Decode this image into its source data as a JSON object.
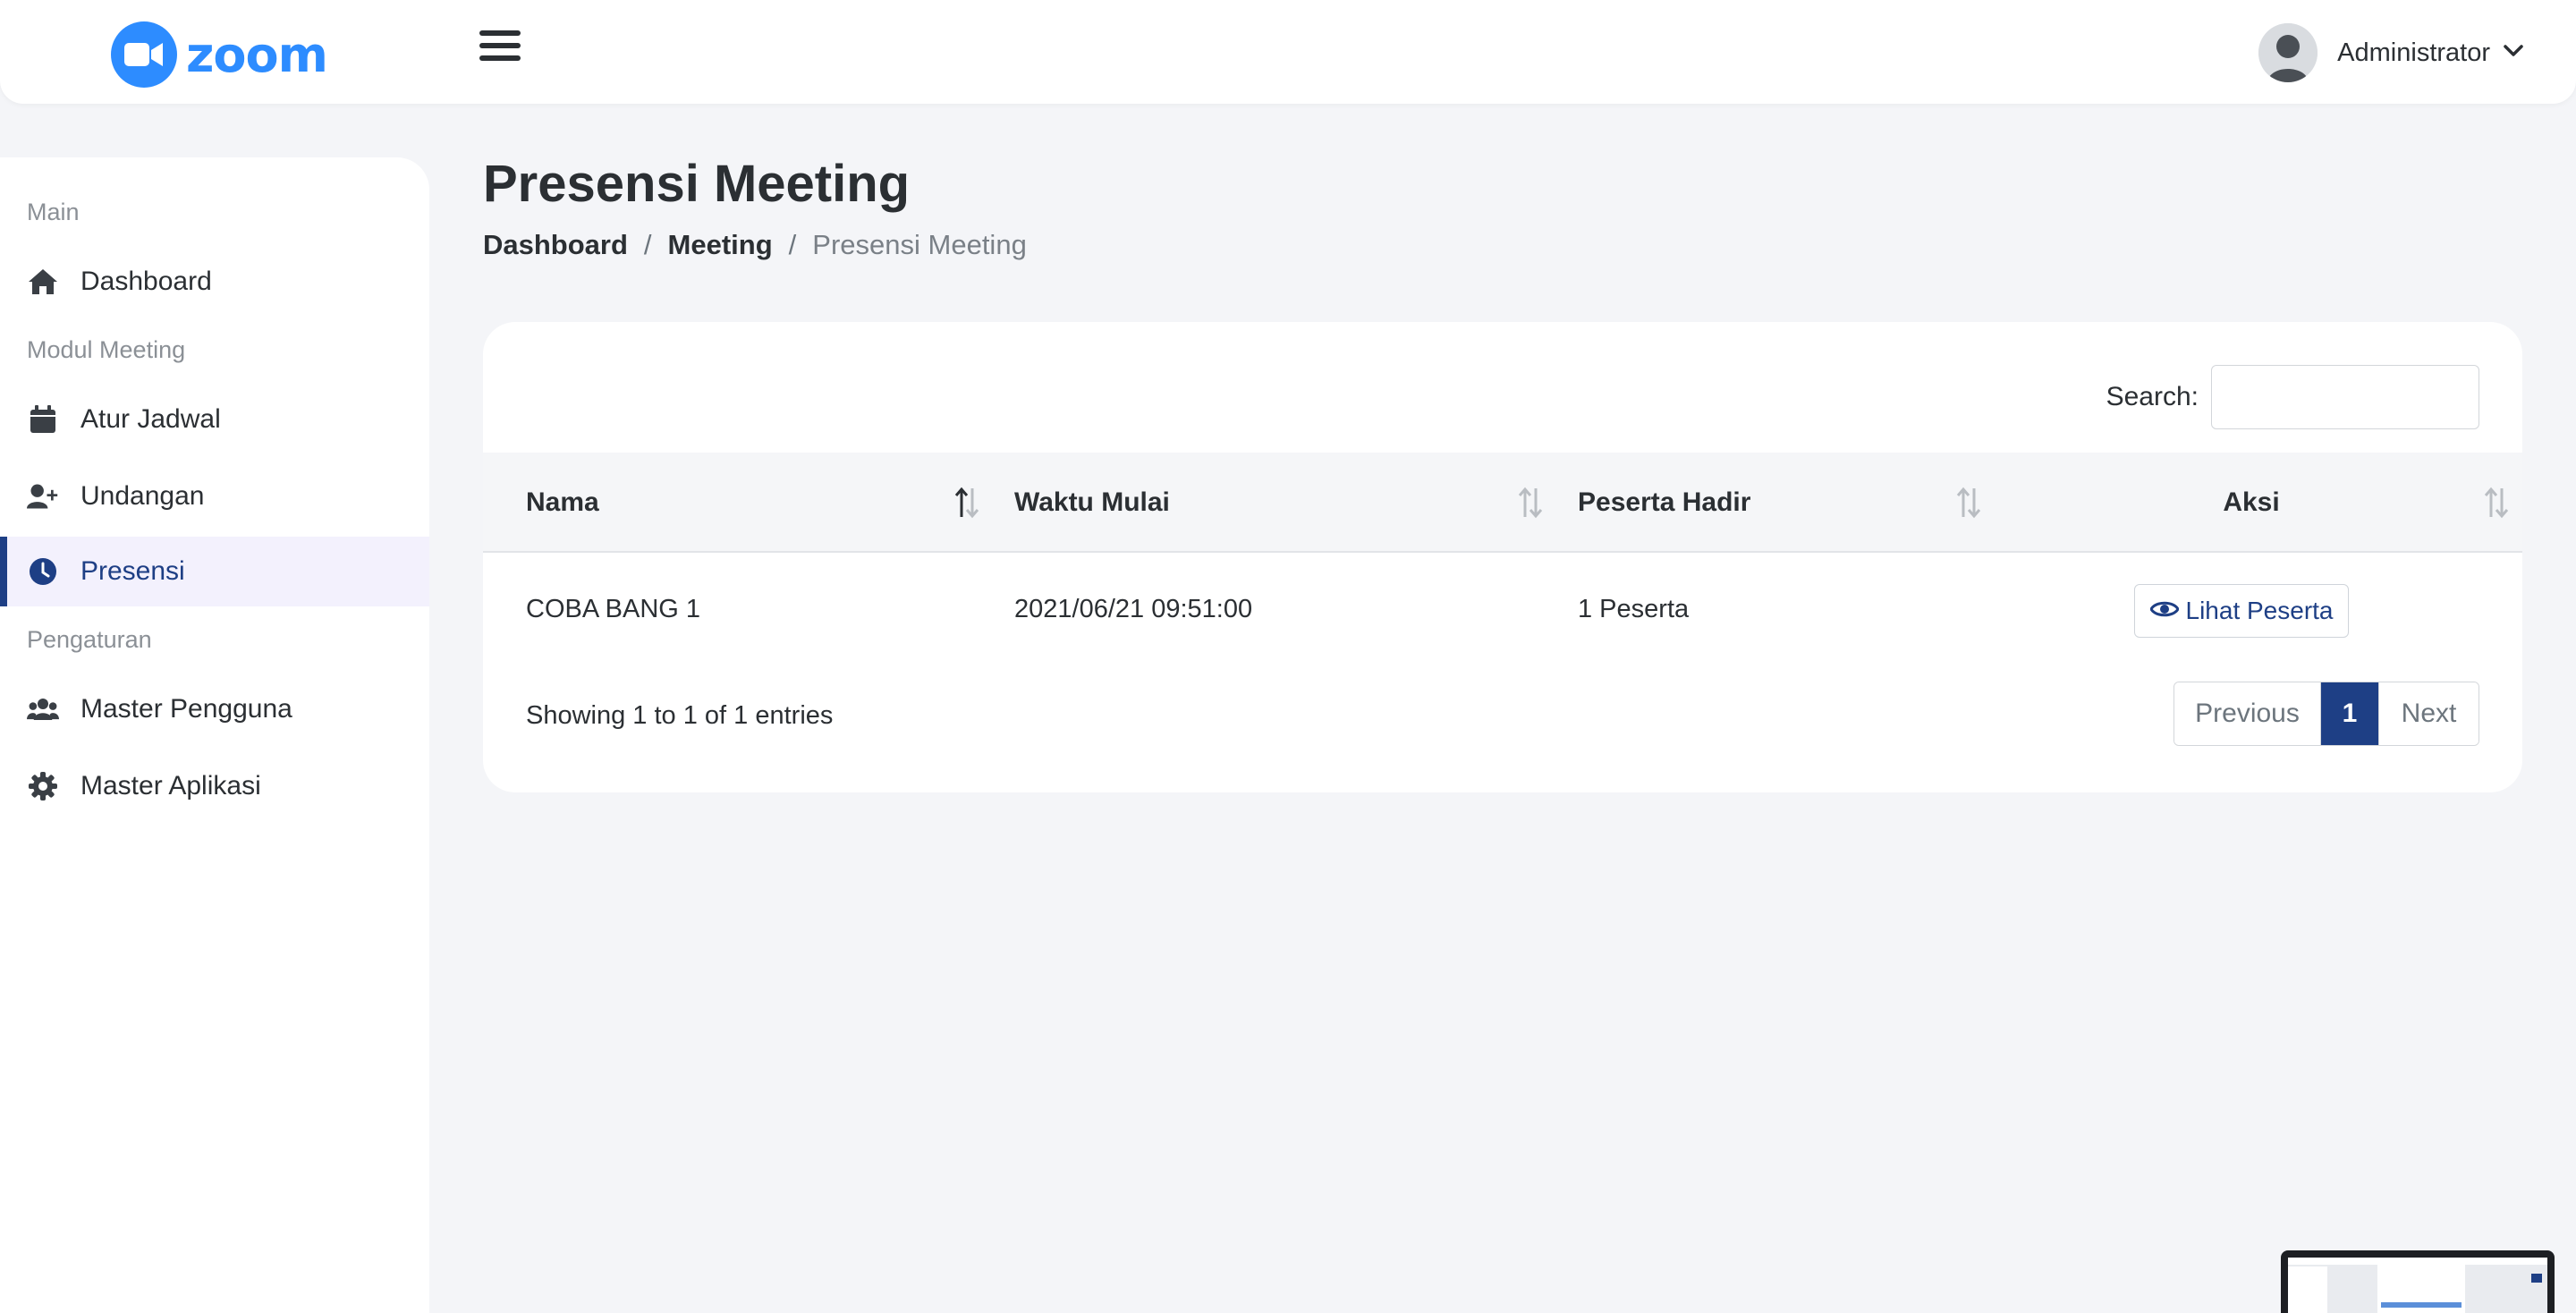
{
  "brand": {
    "name": "zoom",
    "color": "#2d8cff"
  },
  "topbar": {
    "menu_icon": "hamburger-icon",
    "user_name": "Administrator",
    "user_icon": "avatar-icon",
    "dropdown_icon": "chevron-down-icon"
  },
  "sidebar": {
    "sections": [
      {
        "label": "Main"
      },
      {
        "label": "Modul Meeting"
      },
      {
        "label": "Pengaturan"
      }
    ],
    "items": [
      {
        "label": "Dashboard",
        "icon": "home-icon"
      },
      {
        "label": "Atur Jadwal",
        "icon": "calendar-icon"
      },
      {
        "label": "Undangan",
        "icon": "user-plus-icon"
      },
      {
        "label": "Presensi",
        "icon": "clock-icon",
        "active": true
      },
      {
        "label": "Master Pengguna",
        "icon": "users-icon"
      },
      {
        "label": "Master Aplikasi",
        "icon": "gear-icon"
      }
    ]
  },
  "page": {
    "title": "Presensi Meeting",
    "breadcrumb": [
      "Dashboard",
      "Meeting",
      "Presensi Meeting"
    ],
    "breadcrumb_separator": "/"
  },
  "table": {
    "search_label": "Search:",
    "search_value": "",
    "columns": [
      "Nama",
      "Waktu Mulai",
      "Peserta Hadir",
      "Aksi"
    ],
    "rows": [
      {
        "nama": "COBA BANG 1",
        "waktu_mulai": "2021/06/21 09:51:00",
        "peserta_hadir": "1 Peserta",
        "aksi_label": "Lihat Peserta",
        "aksi_icon": "eye-icon"
      }
    ],
    "info": "Showing 1 to 1 of 1 entries",
    "pagination": {
      "previous": "Previous",
      "current": "1",
      "next": "Next"
    }
  },
  "colors": {
    "primary": "#1e3f85",
    "background": "#f4f5f8",
    "active_bg": "#f3f1fd"
  }
}
